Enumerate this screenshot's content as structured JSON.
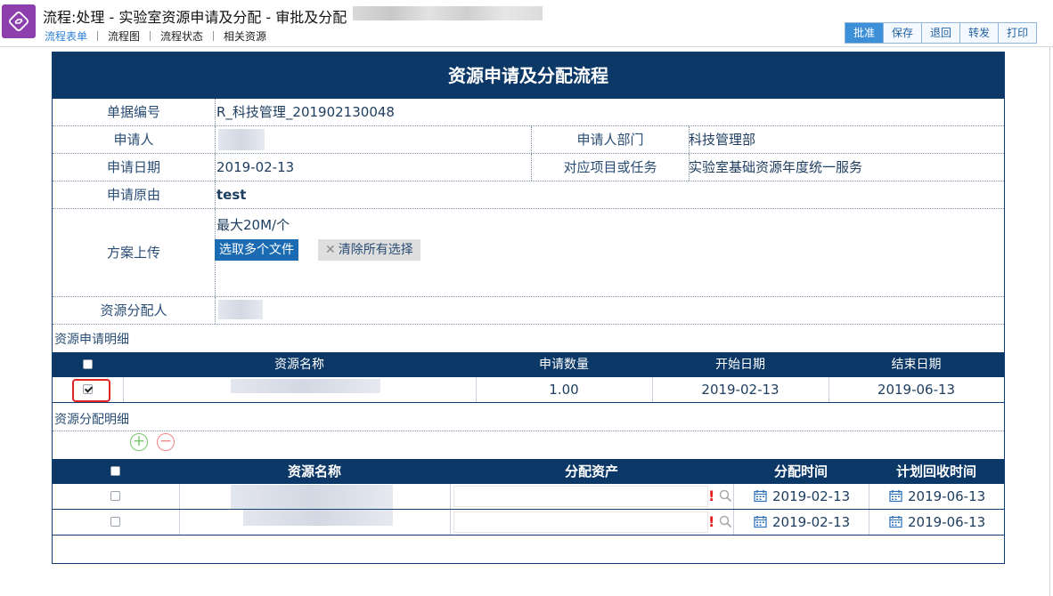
{
  "window": {
    "title": "流程:处理 - 实验室资源申请及分配 - 审批及分配"
  },
  "tabs": [
    {
      "label": "流程表单",
      "active": true
    },
    {
      "label": "流程图"
    },
    {
      "label": "流程状态"
    },
    {
      "label": "相关资源"
    }
  ],
  "toolbar": {
    "approve": "批准",
    "save": "保存",
    "return": "退回",
    "forward": "转发",
    "print": "打印"
  },
  "form": {
    "title": "资源申请及分配流程",
    "fields": {
      "doc_no_label": "单据编号",
      "doc_no": "R_科技管理_201902130048",
      "applicant_label": "申请人",
      "dept_label": "申请人部门",
      "dept": "科技管理部",
      "apply_date_label": "申请日期",
      "apply_date": "2019-02-13",
      "project_label": "对应项目或任务",
      "project": "实验室基础资源年度统一服务",
      "reason_label": "申请原由",
      "reason": "test",
      "upload_label": "方案上传",
      "upload_hint": "最大20M/个",
      "pick_files": "选取多个文件",
      "clear_selection": "清除所有选择",
      "allocator_label": "资源分配人"
    },
    "request_detail": {
      "title": "资源申请明细",
      "headers": {
        "name": "资源名称",
        "qty": "申请数量",
        "start": "开始日期",
        "end": "结束日期"
      },
      "rows": [
        {
          "checked": true,
          "qty": "1.00",
          "start": "2019-02-13",
          "end": "2019-06-13"
        }
      ]
    },
    "alloc_detail": {
      "title": "资源分配明细",
      "headers": {
        "name": "资源名称",
        "asset": "分配资产",
        "time": "分配时间",
        "recall": "计划回收时间"
      },
      "rows": [
        {
          "alloc_time": "2019-02-13",
          "recall_time": "2019-06-13",
          "required_mark": "!"
        },
        {
          "alloc_time": "2019-02-13",
          "recall_time": "2019-06-13",
          "required_mark": "!"
        }
      ]
    }
  },
  "colors": {
    "header_bg": "#0c3868",
    "logo": "#8e3fae",
    "active_tab": "#2f7fd3",
    "approve_btn": "#3d8fd8",
    "required": "#e31d1d",
    "highlight": "#e02424"
  }
}
